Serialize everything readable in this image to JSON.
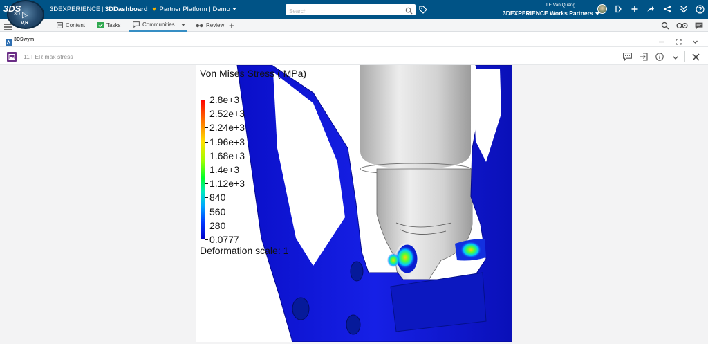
{
  "topbar": {
    "brand": "3DEXPERIENCE",
    "app": "3DDashboard",
    "dashboard": "Partner Platform | Demo",
    "search_placeholder": "Search",
    "user_name": "LE Van Quang",
    "platform": "3DEXPERIENCE Works Partners",
    "compass_user": "V,R",
    "compass_count": "3D",
    "ds_logo": "3DS",
    "colors": {
      "bar": "#005386",
      "heart": "#f5b400"
    }
  },
  "tabs": [
    {
      "label": "Content",
      "icon": "document-icon"
    },
    {
      "label": "Tasks",
      "icon": "checkbox-icon"
    },
    {
      "label": "Communities",
      "icon": "chat-icon",
      "active": true
    },
    {
      "label": "Review",
      "icon": "glasses-icon"
    }
  ],
  "widget": {
    "title": "3DSwym"
  },
  "post": {
    "title": "11 FER max stress"
  },
  "viewer": {
    "legend_title": "Von Mises Stress ( MPa)",
    "legend_labels": [
      "2.8e+3",
      "2.52e+3",
      "2.24e+3",
      "1.96e+3",
      "1.68e+3",
      "1.4e+3",
      "1.12e+3",
      "840",
      "560",
      "280",
      "0.0777"
    ],
    "deformation_label": "Deformation scale: 1"
  }
}
